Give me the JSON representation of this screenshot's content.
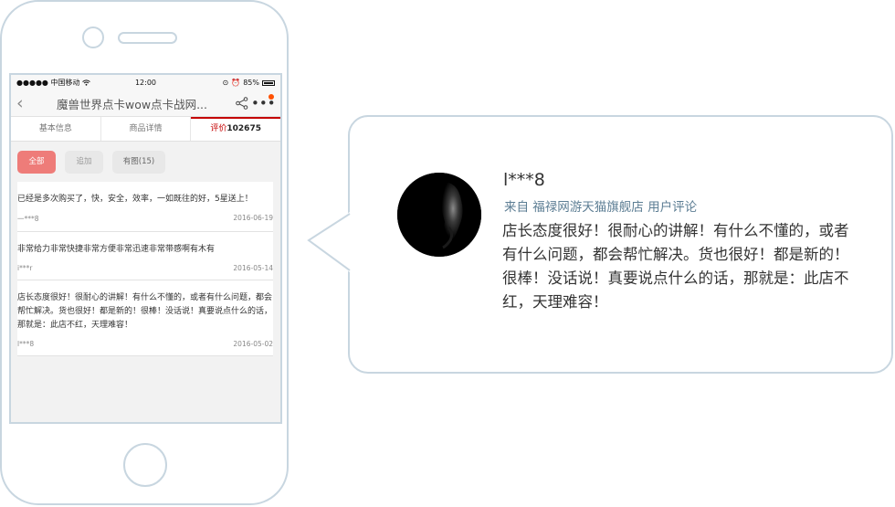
{
  "status_bar": {
    "carrier": "●●●●● 中国移动",
    "time": "12:00",
    "battery": "85%"
  },
  "nav": {
    "title": "魔兽世界点卡wow点卡战网..."
  },
  "tabs": [
    {
      "label": "基本信息"
    },
    {
      "label": "商品详情"
    },
    {
      "label": "评价",
      "count": "102675"
    }
  ],
  "filters": [
    {
      "label": "全部"
    },
    {
      "label": "追加"
    },
    {
      "label": "有图(15)"
    }
  ],
  "reviews": [
    {
      "text": "已经是多次购买了，快，安全，效率，一如既往的好，5星送上！",
      "user": "一***8",
      "date": "2016-06-19"
    },
    {
      "text": "非常给力非常快捷非常方便非常迅速非常带感啊有木有",
      "user": "i***r",
      "date": "2016-05-14"
    },
    {
      "text": "店长态度很好！很耐心的讲解！有什么不懂的，或者有什么问题，都会帮忙解决。货也很好！都是新的！很棒！没话说！真要说点什么的话，那就是：此店不红，天理难容！",
      "user": "l***8",
      "date": "2016-05-02"
    }
  ],
  "bubble": {
    "user": "l***8",
    "source": "来自 福禄网游天猫旗舰店 用户评论",
    "text": "店长态度很好！很耐心的讲解！有什么不懂的，或者有什么问题，都会帮忙解决。货也很好！都是新的！很棒！没话说！真要说点什么的话，那就是：此店不红，天理难容！"
  },
  "colors": {
    "accent": "#c40000",
    "chip_active": "#ee7c79",
    "outline": "#c8d6e0",
    "source_text": "#5d7e94"
  }
}
